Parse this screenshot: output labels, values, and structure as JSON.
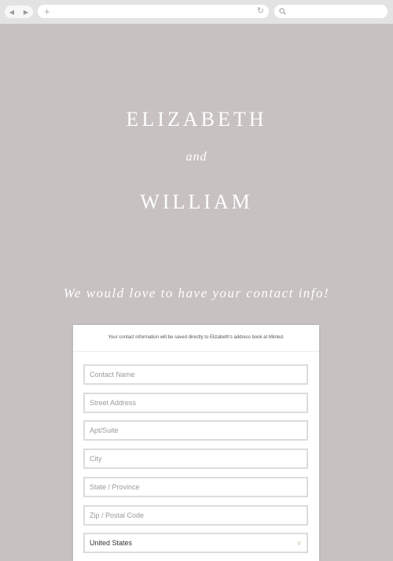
{
  "browser": {
    "back_glyph": "◀",
    "forward_glyph": "▶",
    "new_tab_glyph": "+",
    "reload_glyph": "↻",
    "search_icon": "search-icon"
  },
  "hero": {
    "name_one": "ELIZABETH",
    "connector": "and",
    "name_two": "WILLIAM",
    "tagline": "We would love to have your contact info!"
  },
  "form": {
    "note": "Your contact information will be saved directly to Elizabeth's address book at Minted.",
    "fields": [
      {
        "placeholder": "Contact Name"
      },
      {
        "placeholder": "Street Address"
      },
      {
        "placeholder": "Apt/Suite"
      },
      {
        "placeholder": "City"
      },
      {
        "placeholder": "State / Province"
      },
      {
        "placeholder": "Zip / Postal Code"
      }
    ],
    "country": {
      "value": "United States",
      "chevron": "∨"
    }
  },
  "colors": {
    "background": "#c8c1c1",
    "text_light": "#ffffff",
    "field_border": "#dcdcdc"
  }
}
